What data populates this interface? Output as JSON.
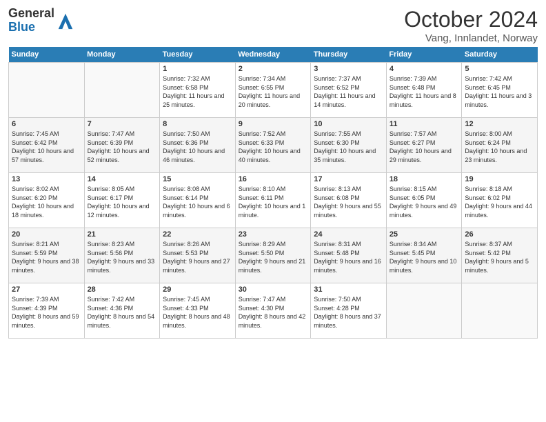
{
  "header": {
    "logo": {
      "general": "General",
      "blue": "Blue"
    },
    "title": "October 2024",
    "location": "Vang, Innlandet, Norway"
  },
  "calendar": {
    "weekdays": [
      "Sunday",
      "Monday",
      "Tuesday",
      "Wednesday",
      "Thursday",
      "Friday",
      "Saturday"
    ],
    "weeks": [
      [
        {
          "day": "",
          "info": ""
        },
        {
          "day": "",
          "info": ""
        },
        {
          "day": "1",
          "info": "Sunrise: 7:32 AM\nSunset: 6:58 PM\nDaylight: 11 hours\nand 25 minutes."
        },
        {
          "day": "2",
          "info": "Sunrise: 7:34 AM\nSunset: 6:55 PM\nDaylight: 11 hours\nand 20 minutes."
        },
        {
          "day": "3",
          "info": "Sunrise: 7:37 AM\nSunset: 6:52 PM\nDaylight: 11 hours\nand 14 minutes."
        },
        {
          "day": "4",
          "info": "Sunrise: 7:39 AM\nSunset: 6:48 PM\nDaylight: 11 hours\nand 8 minutes."
        },
        {
          "day": "5",
          "info": "Sunrise: 7:42 AM\nSunset: 6:45 PM\nDaylight: 11 hours\nand 3 minutes."
        }
      ],
      [
        {
          "day": "6",
          "info": "Sunrise: 7:45 AM\nSunset: 6:42 PM\nDaylight: 10 hours\nand 57 minutes."
        },
        {
          "day": "7",
          "info": "Sunrise: 7:47 AM\nSunset: 6:39 PM\nDaylight: 10 hours\nand 52 minutes."
        },
        {
          "day": "8",
          "info": "Sunrise: 7:50 AM\nSunset: 6:36 PM\nDaylight: 10 hours\nand 46 minutes."
        },
        {
          "day": "9",
          "info": "Sunrise: 7:52 AM\nSunset: 6:33 PM\nDaylight: 10 hours\nand 40 minutes."
        },
        {
          "day": "10",
          "info": "Sunrise: 7:55 AM\nSunset: 6:30 PM\nDaylight: 10 hours\nand 35 minutes."
        },
        {
          "day": "11",
          "info": "Sunrise: 7:57 AM\nSunset: 6:27 PM\nDaylight: 10 hours\nand 29 minutes."
        },
        {
          "day": "12",
          "info": "Sunrise: 8:00 AM\nSunset: 6:24 PM\nDaylight: 10 hours\nand 23 minutes."
        }
      ],
      [
        {
          "day": "13",
          "info": "Sunrise: 8:02 AM\nSunset: 6:20 PM\nDaylight: 10 hours\nand 18 minutes."
        },
        {
          "day": "14",
          "info": "Sunrise: 8:05 AM\nSunset: 6:17 PM\nDaylight: 10 hours\nand 12 minutes."
        },
        {
          "day": "15",
          "info": "Sunrise: 8:08 AM\nSunset: 6:14 PM\nDaylight: 10 hours\nand 6 minutes."
        },
        {
          "day": "16",
          "info": "Sunrise: 8:10 AM\nSunset: 6:11 PM\nDaylight: 10 hours\nand 1 minute."
        },
        {
          "day": "17",
          "info": "Sunrise: 8:13 AM\nSunset: 6:08 PM\nDaylight: 9 hours\nand 55 minutes."
        },
        {
          "day": "18",
          "info": "Sunrise: 8:15 AM\nSunset: 6:05 PM\nDaylight: 9 hours\nand 49 minutes."
        },
        {
          "day": "19",
          "info": "Sunrise: 8:18 AM\nSunset: 6:02 PM\nDaylight: 9 hours\nand 44 minutes."
        }
      ],
      [
        {
          "day": "20",
          "info": "Sunrise: 8:21 AM\nSunset: 5:59 PM\nDaylight: 9 hours\nand 38 minutes."
        },
        {
          "day": "21",
          "info": "Sunrise: 8:23 AM\nSunset: 5:56 PM\nDaylight: 9 hours\nand 33 minutes."
        },
        {
          "day": "22",
          "info": "Sunrise: 8:26 AM\nSunset: 5:53 PM\nDaylight: 9 hours\nand 27 minutes."
        },
        {
          "day": "23",
          "info": "Sunrise: 8:29 AM\nSunset: 5:50 PM\nDaylight: 9 hours\nand 21 minutes."
        },
        {
          "day": "24",
          "info": "Sunrise: 8:31 AM\nSunset: 5:48 PM\nDaylight: 9 hours\nand 16 minutes."
        },
        {
          "day": "25",
          "info": "Sunrise: 8:34 AM\nSunset: 5:45 PM\nDaylight: 9 hours\nand 10 minutes."
        },
        {
          "day": "26",
          "info": "Sunrise: 8:37 AM\nSunset: 5:42 PM\nDaylight: 9 hours\nand 5 minutes."
        }
      ],
      [
        {
          "day": "27",
          "info": "Sunrise: 7:39 AM\nSunset: 4:39 PM\nDaylight: 8 hours\nand 59 minutes."
        },
        {
          "day": "28",
          "info": "Sunrise: 7:42 AM\nSunset: 4:36 PM\nDaylight: 8 hours\nand 54 minutes."
        },
        {
          "day": "29",
          "info": "Sunrise: 7:45 AM\nSunset: 4:33 PM\nDaylight: 8 hours\nand 48 minutes."
        },
        {
          "day": "30",
          "info": "Sunrise: 7:47 AM\nSunset: 4:30 PM\nDaylight: 8 hours\nand 42 minutes."
        },
        {
          "day": "31",
          "info": "Sunrise: 7:50 AM\nSunset: 4:28 PM\nDaylight: 8 hours\nand 37 minutes."
        },
        {
          "day": "",
          "info": ""
        },
        {
          "day": "",
          "info": ""
        }
      ]
    ]
  }
}
